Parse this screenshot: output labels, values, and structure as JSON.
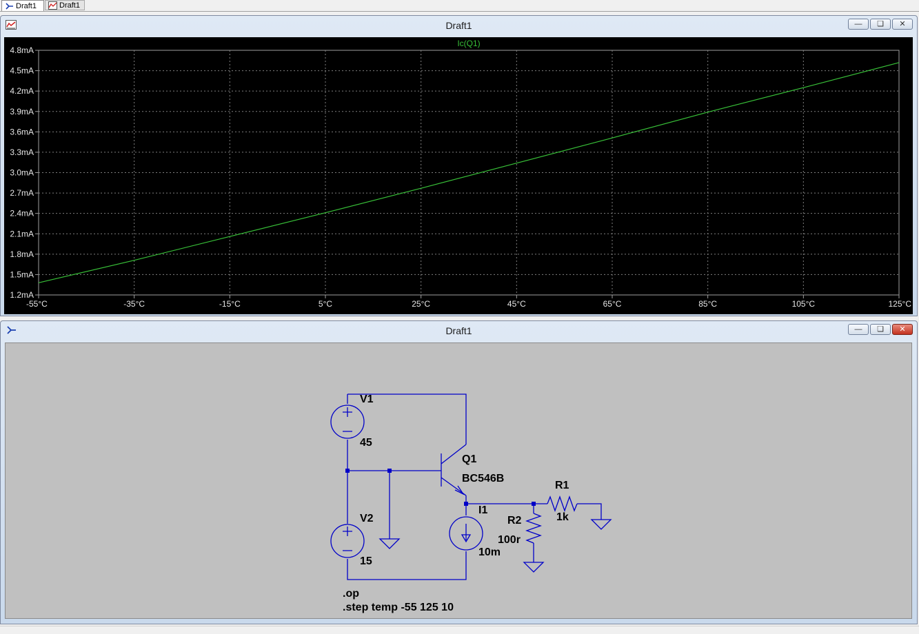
{
  "tabs": [
    {
      "label": "Draft1",
      "icon": "schematic-icon",
      "active": true
    },
    {
      "label": "Draft1",
      "icon": "waveform-icon",
      "active": false
    }
  ],
  "plot_window": {
    "title": "Draft1",
    "icon": "waveform-icon",
    "trace_color": "#38c038",
    "grid_color": "#808080"
  },
  "schematic_window": {
    "title": "Draft1",
    "icon": "schematic-icon",
    "wire_color": "#0000c8"
  },
  "window_controls": [
    "minimize-icon",
    "restore-icon",
    "close-icon"
  ],
  "chart_data": {
    "type": "line",
    "title": "Ic(Q1)",
    "xlabel": "",
    "ylabel": "",
    "x_ticks": [
      "-55°C",
      "-35°C",
      "-15°C",
      "5°C",
      "25°C",
      "45°C",
      "65°C",
      "85°C",
      "105°C",
      "125°C"
    ],
    "y_ticks": [
      "4.8mA",
      "4.5mA",
      "4.2mA",
      "3.9mA",
      "3.6mA",
      "3.3mA",
      "3.0mA",
      "2.7mA",
      "2.4mA",
      "2.1mA",
      "1.8mA",
      "1.5mA",
      "1.2mA"
    ],
    "xlim": [
      -55,
      125
    ],
    "ylim": [
      1.2,
      4.8
    ],
    "grid": true,
    "series": [
      {
        "name": "Ic(Q1)",
        "x": [
          -55,
          -35,
          -15,
          5,
          25,
          45,
          65,
          85,
          105,
          125
        ],
        "y": [
          1.38,
          1.71,
          2.06,
          2.41,
          2.77,
          3.14,
          3.51,
          3.89,
          4.25,
          4.62
        ]
      }
    ]
  },
  "schematic": {
    "components": {
      "v1": {
        "name": "V1",
        "value": "45"
      },
      "v2": {
        "name": "V2",
        "value": "15"
      },
      "q1": {
        "name": "Q1",
        "value": "BC546B"
      },
      "i1": {
        "name": "I1",
        "value": "10m"
      },
      "r1": {
        "name": "R1",
        "value": "1k"
      },
      "r2": {
        "name": "R2",
        "value": "100r"
      }
    },
    "directives": [
      ".op",
      ".step temp -55 125 10"
    ]
  }
}
